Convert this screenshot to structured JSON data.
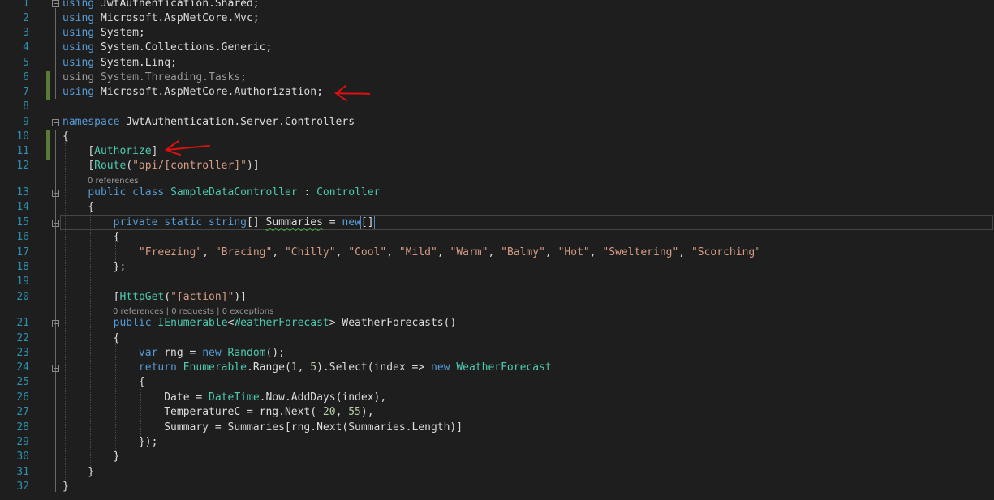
{
  "editor": {
    "lines": [
      {
        "n": "1",
        "code": "using JwtAuthentication.Shared;"
      },
      {
        "n": "2",
        "code": "using Microsoft.AspNetCore.Mvc;"
      },
      {
        "n": "3",
        "code": "using System;"
      },
      {
        "n": "4",
        "code": "using System.Collections.Generic;"
      },
      {
        "n": "5",
        "code": "using System.Linq;"
      },
      {
        "n": "6",
        "code": "using System.Threading.Tasks;"
      },
      {
        "n": "7",
        "code": "using Microsoft.AspNetCore.Authorization;"
      },
      {
        "n": "8",
        "code": ""
      },
      {
        "n": "9",
        "code": "namespace JwtAuthentication.Server.Controllers"
      },
      {
        "n": "10",
        "code": "{"
      },
      {
        "n": "11",
        "code": "    [Authorize]"
      },
      {
        "n": "12",
        "code": "    [Route(\"api/[controller]\")]"
      },
      {
        "n": "13",
        "code": "    public class SampleDataController : Controller"
      },
      {
        "n": "14",
        "code": "    {"
      },
      {
        "n": "15",
        "code": "        private static string[] Summaries = new[]"
      },
      {
        "n": "16",
        "code": "        {"
      },
      {
        "n": "17",
        "code": "            \"Freezing\", \"Bracing\", \"Chilly\", \"Cool\", \"Mild\", \"Warm\", \"Balmy\", \"Hot\", \"Sweltering\", \"Scorching\""
      },
      {
        "n": "18",
        "code": "        };"
      },
      {
        "n": "19",
        "code": ""
      },
      {
        "n": "20",
        "code": "        [HttpGet(\"[action]\")]"
      },
      {
        "n": "21",
        "code": "        public IEnumerable<WeatherForecast> WeatherForecasts()"
      },
      {
        "n": "22",
        "code": "        {"
      },
      {
        "n": "23",
        "code": "            var rng = new Random();"
      },
      {
        "n": "24",
        "code": "            return Enumerable.Range(1, 5).Select(index => new WeatherForecast"
      },
      {
        "n": "25",
        "code": "            {"
      },
      {
        "n": "26",
        "code": "                Date = DateTime.Now.AddDays(index),"
      },
      {
        "n": "27",
        "code": "                TemperatureC = rng.Next(-20, 55),"
      },
      {
        "n": "28",
        "code": "                Summary = Summaries[rng.Next(Summaries.Length)]"
      },
      {
        "n": "29",
        "code": "            });"
      },
      {
        "n": "30",
        "code": "        }"
      },
      {
        "n": "31",
        "code": "    }"
      },
      {
        "n": "32",
        "code": "}"
      }
    ],
    "codelens": {
      "class_refs": "0 references",
      "method_refs": "0 references | 0 requests | 0 exceptions"
    }
  },
  "colors": {
    "background": "#1e1e1e",
    "line_number": "#2b91af",
    "keyword": "#569cd6",
    "type": "#4ec9b0",
    "string": "#d69d85",
    "number": "#b5cea8",
    "change_marker": "#5a7d36",
    "annotation_arrow": "#e01010"
  },
  "annotations": [
    "arrow-pointing-to-using-authorization",
    "arrow-pointing-to-authorize-attribute"
  ]
}
